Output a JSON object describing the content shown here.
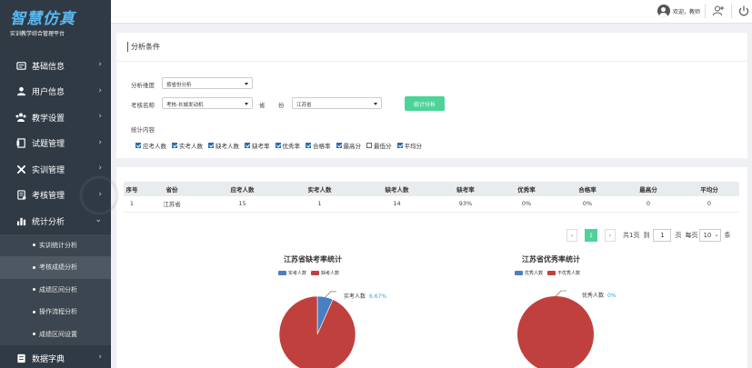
{
  "brand": {
    "title": "智慧仿真",
    "subtitle": "实训教学综合管理平台"
  },
  "header": {
    "greeting": "欢迎，教师"
  },
  "sidebar": {
    "items": [
      {
        "label": "基础信息",
        "icon": "database-icon"
      },
      {
        "label": "用户信息",
        "icon": "user-icon"
      },
      {
        "label": "教学设置",
        "icon": "teaching-icon"
      },
      {
        "label": "试题管理",
        "icon": "question-bank-icon"
      },
      {
        "label": "实训管理",
        "icon": "tools-icon"
      },
      {
        "label": "考核管理",
        "icon": "exam-icon"
      },
      {
        "label": "统计分析",
        "icon": "bar-chart-icon"
      }
    ],
    "subitems": [
      {
        "label": "实训统计分析"
      },
      {
        "label": "考核成绩分析"
      },
      {
        "label": "成绩区间分析"
      },
      {
        "label": "操作流程分析"
      },
      {
        "label": "成绩区间设置"
      }
    ],
    "last_item": {
      "label": "数据字典",
      "icon": "dictionary-icon"
    }
  },
  "filter": {
    "title": "分析条件",
    "dimension_label": "分析维度",
    "dimension_value": "按省份分析",
    "exam_label": "考核名称",
    "exam_value": "考核-长城发动机",
    "province_label_1": "省",
    "province_label_2": "份",
    "province_value": "江苏省",
    "analyze_button": "统计分析",
    "content_label": "统计内容",
    "options": [
      {
        "label": "应考人数",
        "checked": true
      },
      {
        "label": "实考人数",
        "checked": true
      },
      {
        "label": "缺考人数",
        "checked": true
      },
      {
        "label": "缺考率",
        "checked": true
      },
      {
        "label": "优秀率",
        "checked": true
      },
      {
        "label": "合格率",
        "checked": true
      },
      {
        "label": "最高分",
        "checked": true
      },
      {
        "label": "最低分",
        "checked": false
      },
      {
        "label": "平均分",
        "checked": true
      }
    ]
  },
  "table": {
    "headers": [
      "序号",
      "省份",
      "应考人数",
      "实考人数",
      "缺考人数",
      "缺考率",
      "优秀率",
      "合格率",
      "最高分",
      "平均分"
    ],
    "rows": [
      [
        "1",
        "江苏省",
        "15",
        "1",
        "14",
        "93%",
        "0%",
        "0%",
        "0",
        "0"
      ]
    ]
  },
  "pager": {
    "prev": "‹",
    "current": "1",
    "next": "›",
    "total_pages": "共1页",
    "goto_prefix": "到",
    "goto_value": "1",
    "goto_suffix": "页",
    "per_page_label": "每页",
    "per_page_value": "10",
    "per_page_unit": "条"
  },
  "colors": {
    "blue": "#4a7fc1",
    "red": "#c0403d",
    "accent": "#4cd39a"
  },
  "chart_data": [
    {
      "type": "pie",
      "title": "江苏省缺考率统计",
      "labels": [
        "实考人数",
        "缺考人数"
      ],
      "values": [
        6.67,
        93.33
      ],
      "annotations": [
        {
          "label": "实考人数",
          "value": "6.67%"
        }
      ]
    },
    {
      "type": "pie",
      "title": "江苏省优秀率统计",
      "labels": [
        "优秀人数",
        "不优秀人数"
      ],
      "values": [
        0,
        100
      ],
      "annotations": [
        {
          "label": "优秀人数",
          "value": "0%"
        }
      ]
    }
  ]
}
